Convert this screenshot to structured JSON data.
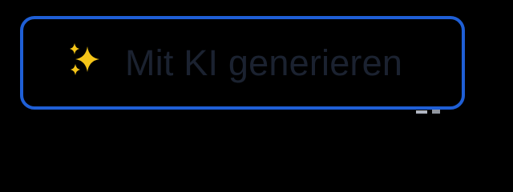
{
  "generate_button": {
    "label": "Mit KI generieren",
    "icon": "sparkles-icon",
    "border_color": "#1f5fd6",
    "text_color": "#1b2230",
    "icon_color": "#f5c518"
  }
}
